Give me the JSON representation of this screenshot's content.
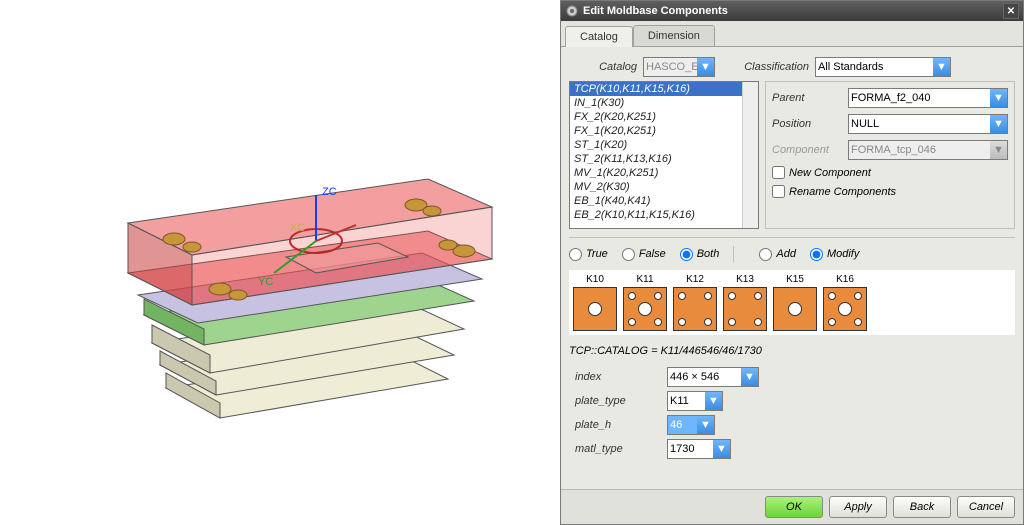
{
  "title": "Edit Moldbase Components",
  "tabs": {
    "catalog": "Catalog",
    "dimension": "Dimension"
  },
  "catalogRow": {
    "label": "Catalog",
    "value": "HASCO_E",
    "classLabel": "Classification",
    "classValue": "All Standards"
  },
  "listbox": {
    "items": [
      "TCP(K10,K11,K15,K16)",
      "IN_1(K30)",
      "FX_2(K20,K251)",
      "FX_1(K20,K251)",
      "ST_1(K20)",
      "ST_2(K11,K13,K16)",
      "MV_1(K20,K251)",
      "MV_2(K30)",
      "EB_1(K40,K41)",
      "EB_2(K10,K11,K15,K16)"
    ],
    "selectedIndex": 0
  },
  "right": {
    "parentLabel": "Parent",
    "parentValue": "FORMA_f2_040",
    "positionLabel": "Position",
    "positionValue": "NULL",
    "componentLabel": "Component",
    "componentValue": "FORMA_tcp_046",
    "newComp": "New Component",
    "renameComp": "Rename Components"
  },
  "radios": {
    "true": "True",
    "false": "False",
    "both": "Both",
    "add": "Add",
    "modify": "Modify",
    "sel1": "Both",
    "sel2": "Modify"
  },
  "thumbs": [
    "K10",
    "K11",
    "K12",
    "K13",
    "K15",
    "K16"
  ],
  "catline": "TCP::CATALOG = K11/446546/46/1730",
  "params": {
    "index": {
      "label": "index",
      "value": "446 × 546"
    },
    "plate_type": {
      "label": "plate_type",
      "value": "K11"
    },
    "plate_h": {
      "label": "plate_h",
      "value": "46"
    },
    "matl_type": {
      "label": "matl_type",
      "value": "1730"
    }
  },
  "buttons": {
    "ok": "OK",
    "apply": "Apply",
    "back": "Back",
    "cancel": "Cancel"
  },
  "axes": {
    "x": "XC",
    "y": "YC",
    "z": "ZC"
  }
}
